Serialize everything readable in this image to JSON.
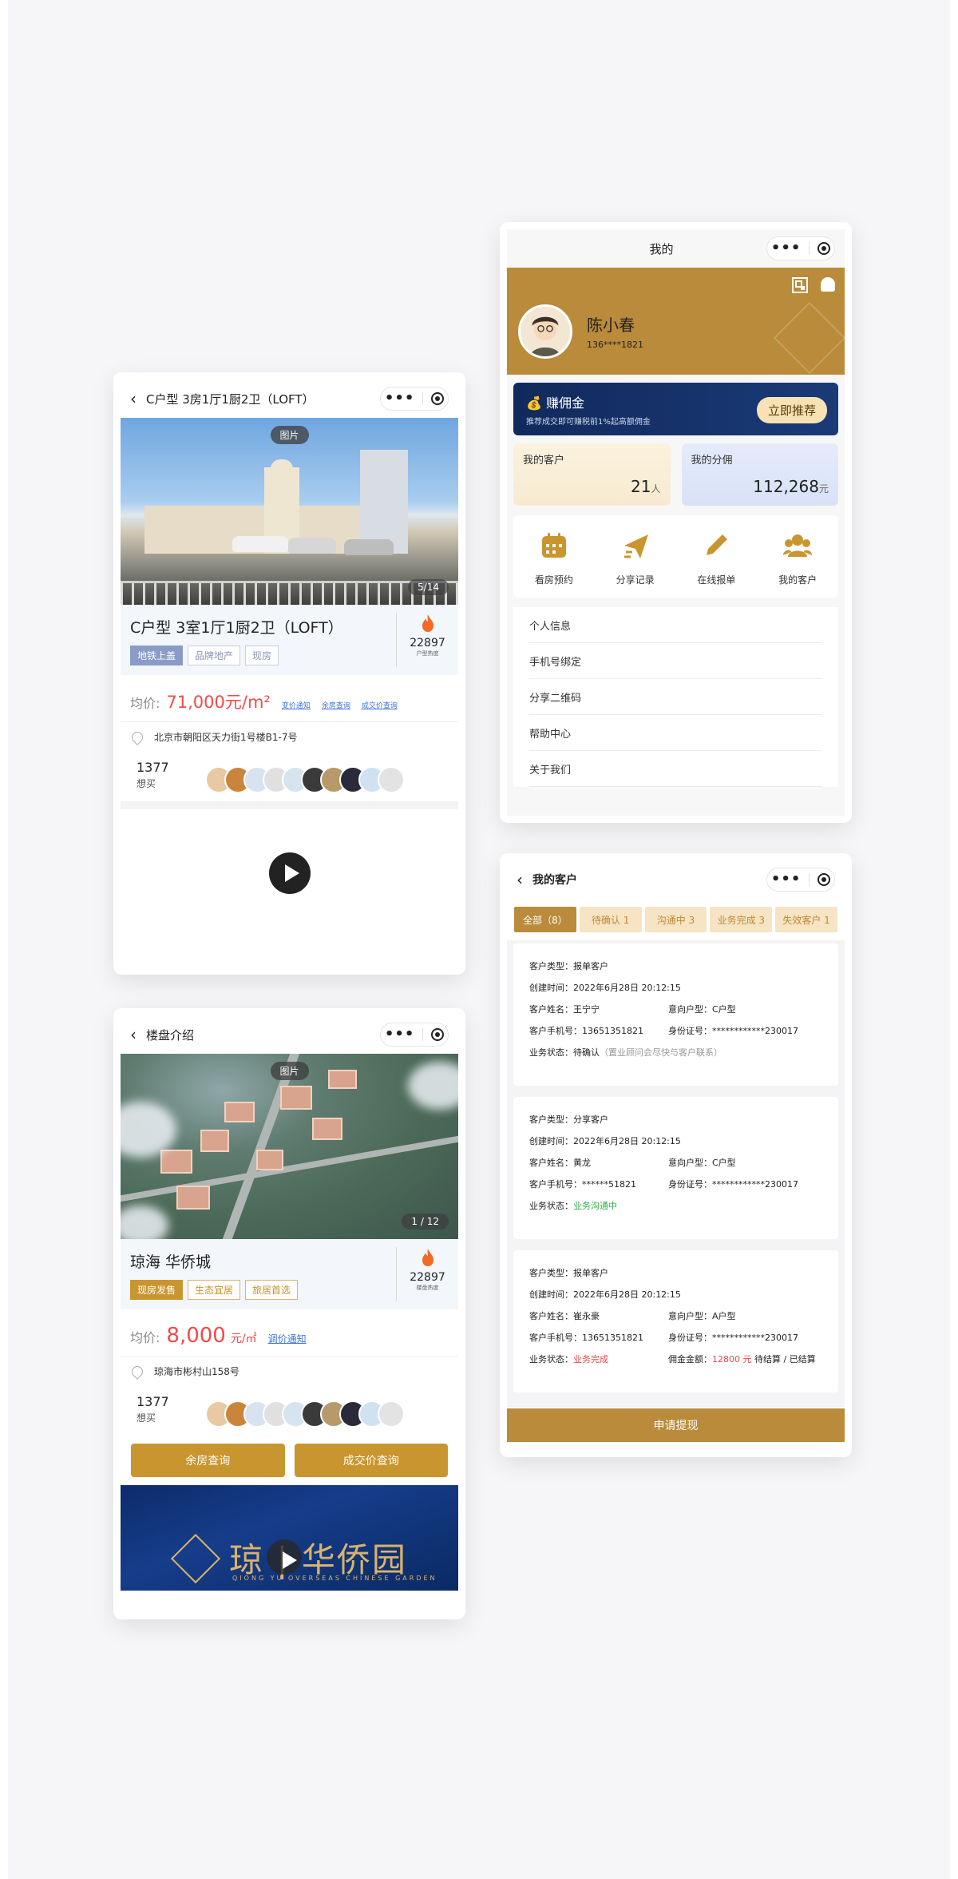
{
  "property_detail": {
    "nav_title": "C户型 3房1厅1厨2卫（LOFT）",
    "photo_label": "图片",
    "photo_counter": "5/14",
    "name": "C户型 3室1厅1厨2卫（LOFT）",
    "tags": [
      "地铁上盖",
      "品牌地产",
      "现房"
    ],
    "heat_value": "22897",
    "heat_label": "户型热度",
    "price_label": "均价:",
    "price_value": "71,000元/m²",
    "links": [
      "变价通知",
      "余房查询",
      "成交价查询"
    ],
    "address": "北京市朝阳区天力街1号楼B1-7号",
    "want_count": "1377",
    "want_label": "想买"
  },
  "estate_intro": {
    "nav_title": "楼盘介绍",
    "photo_label": "图片",
    "photo_counter": "1 / 12",
    "name": "琼海 华侨城",
    "tags": [
      "现房发售",
      "生态宜居",
      "旅居首选"
    ],
    "heat_value": "22897",
    "heat_label": "楼盘热度",
    "price_label": "均价:",
    "price_value": "8,000",
    "price_unit": "元/㎡",
    "price_link": "调价通知",
    "address": "琼海市彬村山158号",
    "want_count": "1377",
    "want_label": "想买",
    "buttons": [
      "余房查询",
      "成交价查询"
    ],
    "banner_title": "琼 | 华侨园",
    "banner_sub": "QIONG YU   OVERSEAS CHINESE GARDEN"
  },
  "profile": {
    "nav_title": "我的",
    "user_name": "陈小春",
    "user_phone": "136****1821",
    "commission_title": "赚佣金",
    "commission_sub": "推荐成交即可赚税前1%起高额佣金",
    "commission_button": "立即推荐",
    "stats": [
      {
        "label": "我的客户",
        "value": "21",
        "unit": "人"
      },
      {
        "label": "我的分佣",
        "value": "112,268",
        "unit": "元"
      }
    ],
    "grid": [
      "看房预约",
      "分享记录",
      "在线报单",
      "我的客户"
    ],
    "menu": [
      "个人信息",
      "手机号绑定",
      "分享二维码",
      "帮助中心",
      "关于我们"
    ]
  },
  "customers": {
    "nav_title": "我的客户",
    "tabs": [
      "全部（8）",
      "待确认 1",
      "沟通中 3",
      "业务完成 3",
      "失效客户 1"
    ],
    "cards": [
      {
        "type": "客户类型：报单客户",
        "created": "创建时间：2022年6月28日 20:12:15",
        "name": "客户姓名：王宁宁",
        "intent": "意向户型：C户型",
        "phone": "客户手机号：13651351821",
        "idno": "身份证号：************230017",
        "status_label": "业务状态：",
        "status": "待确认",
        "status_note": "（置业顾问会尽快与客户联系）"
      },
      {
        "type": "客户类型：分享客户",
        "created": "创建时间：2022年6月28日 20:12:15",
        "name": "客户姓名：黄龙",
        "intent": "意向户型：C户型",
        "phone": "客户手机号：******51821",
        "idno": "身份证号：************230017",
        "status_label": "业务状态：",
        "status": "业务沟通中"
      },
      {
        "type": "客户类型：报单客户",
        "created": "创建时间：2022年6月28日 20:12:15",
        "name": "客户姓名：崔永豪",
        "intent": "意向户型：A户型",
        "phone": "客户手机号：13651351821",
        "idno": "身份证号：************230017",
        "status_label": "业务状态：",
        "status": "业务完成",
        "commission_label": "佣金金额：",
        "commission_value": "12800 元",
        "commission_state": "待结算 / 已结算"
      }
    ],
    "withdraw_button": "申请提现"
  }
}
